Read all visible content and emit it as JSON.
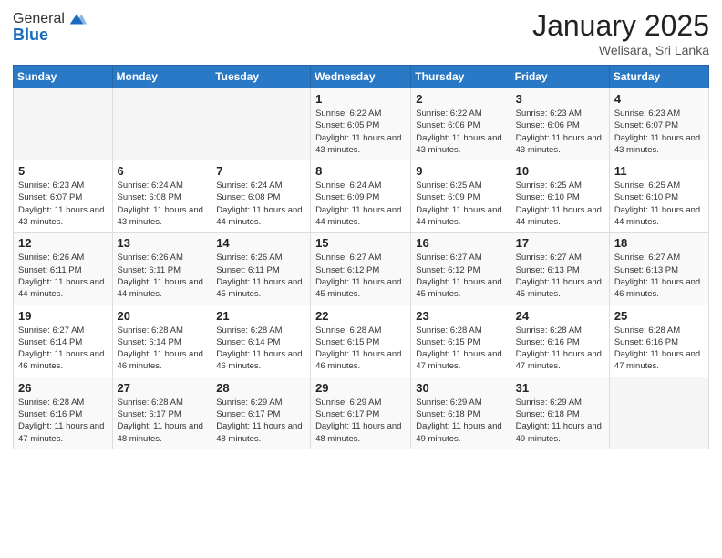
{
  "logo": {
    "general": "General",
    "blue": "Blue"
  },
  "header": {
    "month_year": "January 2025",
    "location": "Welisara, Sri Lanka"
  },
  "days_of_week": [
    "Sunday",
    "Monday",
    "Tuesday",
    "Wednesday",
    "Thursday",
    "Friday",
    "Saturday"
  ],
  "weeks": [
    [
      {
        "day": "",
        "info": ""
      },
      {
        "day": "",
        "info": ""
      },
      {
        "day": "",
        "info": ""
      },
      {
        "day": "1",
        "info": "Sunrise: 6:22 AM\nSunset: 6:05 PM\nDaylight: 11 hours and 43 minutes."
      },
      {
        "day": "2",
        "info": "Sunrise: 6:22 AM\nSunset: 6:06 PM\nDaylight: 11 hours and 43 minutes."
      },
      {
        "day": "3",
        "info": "Sunrise: 6:23 AM\nSunset: 6:06 PM\nDaylight: 11 hours and 43 minutes."
      },
      {
        "day": "4",
        "info": "Sunrise: 6:23 AM\nSunset: 6:07 PM\nDaylight: 11 hours and 43 minutes."
      }
    ],
    [
      {
        "day": "5",
        "info": "Sunrise: 6:23 AM\nSunset: 6:07 PM\nDaylight: 11 hours and 43 minutes."
      },
      {
        "day": "6",
        "info": "Sunrise: 6:24 AM\nSunset: 6:08 PM\nDaylight: 11 hours and 43 minutes."
      },
      {
        "day": "7",
        "info": "Sunrise: 6:24 AM\nSunset: 6:08 PM\nDaylight: 11 hours and 44 minutes."
      },
      {
        "day": "8",
        "info": "Sunrise: 6:24 AM\nSunset: 6:09 PM\nDaylight: 11 hours and 44 minutes."
      },
      {
        "day": "9",
        "info": "Sunrise: 6:25 AM\nSunset: 6:09 PM\nDaylight: 11 hours and 44 minutes."
      },
      {
        "day": "10",
        "info": "Sunrise: 6:25 AM\nSunset: 6:10 PM\nDaylight: 11 hours and 44 minutes."
      },
      {
        "day": "11",
        "info": "Sunrise: 6:25 AM\nSunset: 6:10 PM\nDaylight: 11 hours and 44 minutes."
      }
    ],
    [
      {
        "day": "12",
        "info": "Sunrise: 6:26 AM\nSunset: 6:11 PM\nDaylight: 11 hours and 44 minutes."
      },
      {
        "day": "13",
        "info": "Sunrise: 6:26 AM\nSunset: 6:11 PM\nDaylight: 11 hours and 44 minutes."
      },
      {
        "day": "14",
        "info": "Sunrise: 6:26 AM\nSunset: 6:11 PM\nDaylight: 11 hours and 45 minutes."
      },
      {
        "day": "15",
        "info": "Sunrise: 6:27 AM\nSunset: 6:12 PM\nDaylight: 11 hours and 45 minutes."
      },
      {
        "day": "16",
        "info": "Sunrise: 6:27 AM\nSunset: 6:12 PM\nDaylight: 11 hours and 45 minutes."
      },
      {
        "day": "17",
        "info": "Sunrise: 6:27 AM\nSunset: 6:13 PM\nDaylight: 11 hours and 45 minutes."
      },
      {
        "day": "18",
        "info": "Sunrise: 6:27 AM\nSunset: 6:13 PM\nDaylight: 11 hours and 46 minutes."
      }
    ],
    [
      {
        "day": "19",
        "info": "Sunrise: 6:27 AM\nSunset: 6:14 PM\nDaylight: 11 hours and 46 minutes."
      },
      {
        "day": "20",
        "info": "Sunrise: 6:28 AM\nSunset: 6:14 PM\nDaylight: 11 hours and 46 minutes."
      },
      {
        "day": "21",
        "info": "Sunrise: 6:28 AM\nSunset: 6:14 PM\nDaylight: 11 hours and 46 minutes."
      },
      {
        "day": "22",
        "info": "Sunrise: 6:28 AM\nSunset: 6:15 PM\nDaylight: 11 hours and 46 minutes."
      },
      {
        "day": "23",
        "info": "Sunrise: 6:28 AM\nSunset: 6:15 PM\nDaylight: 11 hours and 47 minutes."
      },
      {
        "day": "24",
        "info": "Sunrise: 6:28 AM\nSunset: 6:16 PM\nDaylight: 11 hours and 47 minutes."
      },
      {
        "day": "25",
        "info": "Sunrise: 6:28 AM\nSunset: 6:16 PM\nDaylight: 11 hours and 47 minutes."
      }
    ],
    [
      {
        "day": "26",
        "info": "Sunrise: 6:28 AM\nSunset: 6:16 PM\nDaylight: 11 hours and 47 minutes."
      },
      {
        "day": "27",
        "info": "Sunrise: 6:28 AM\nSunset: 6:17 PM\nDaylight: 11 hours and 48 minutes."
      },
      {
        "day": "28",
        "info": "Sunrise: 6:29 AM\nSunset: 6:17 PM\nDaylight: 11 hours and 48 minutes."
      },
      {
        "day": "29",
        "info": "Sunrise: 6:29 AM\nSunset: 6:17 PM\nDaylight: 11 hours and 48 minutes."
      },
      {
        "day": "30",
        "info": "Sunrise: 6:29 AM\nSunset: 6:18 PM\nDaylight: 11 hours and 49 minutes."
      },
      {
        "day": "31",
        "info": "Sunrise: 6:29 AM\nSunset: 6:18 PM\nDaylight: 11 hours and 49 minutes."
      },
      {
        "day": "",
        "info": ""
      }
    ]
  ]
}
